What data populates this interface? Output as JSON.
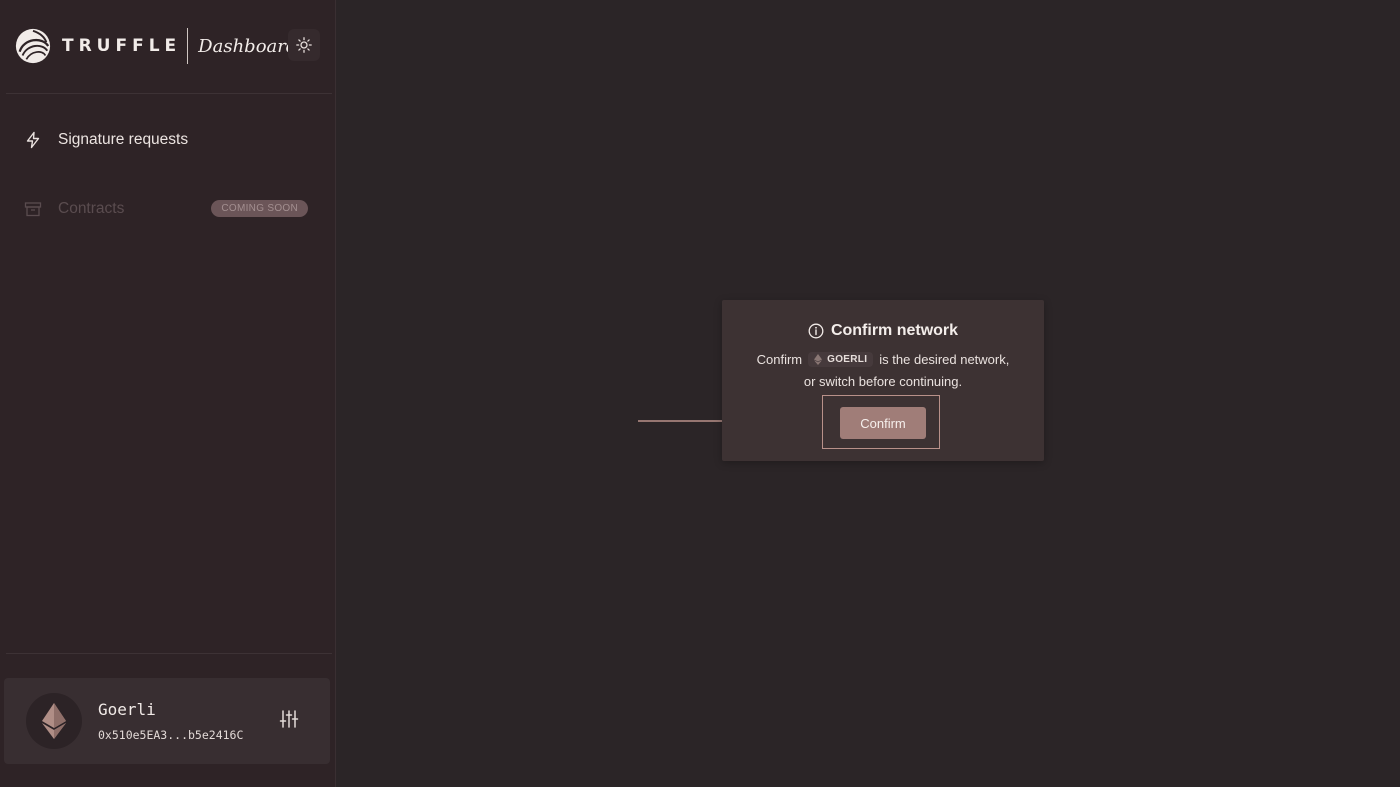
{
  "brand": {
    "wordmark": "TRUFFLE",
    "product": "Dashboard"
  },
  "sidebar": {
    "items": [
      {
        "label": "Signature requests",
        "icon": "lightning-icon",
        "enabled": true
      },
      {
        "label": "Contracts",
        "icon": "archive-box-icon",
        "enabled": false,
        "badge": "COMING SOON"
      }
    ]
  },
  "account": {
    "network_name": "Goerli",
    "address": "0x510e5EA3...b5e2416C",
    "avatar_icon": "ethereum-icon",
    "settings_icon": "sliders-icon"
  },
  "modal": {
    "title": "Confirm network",
    "line1_prefix": "Confirm",
    "network_badge": "GOERLI",
    "line1_suffix": "is the desired network,",
    "line2": "or switch before continuing.",
    "confirm_label": "Confirm"
  },
  "colors": {
    "background": "#2b2527",
    "sidebar": "#2e2326",
    "modal": "#3d3233",
    "accent_button": "#a07d78",
    "highlight_border": "#b9918a"
  }
}
